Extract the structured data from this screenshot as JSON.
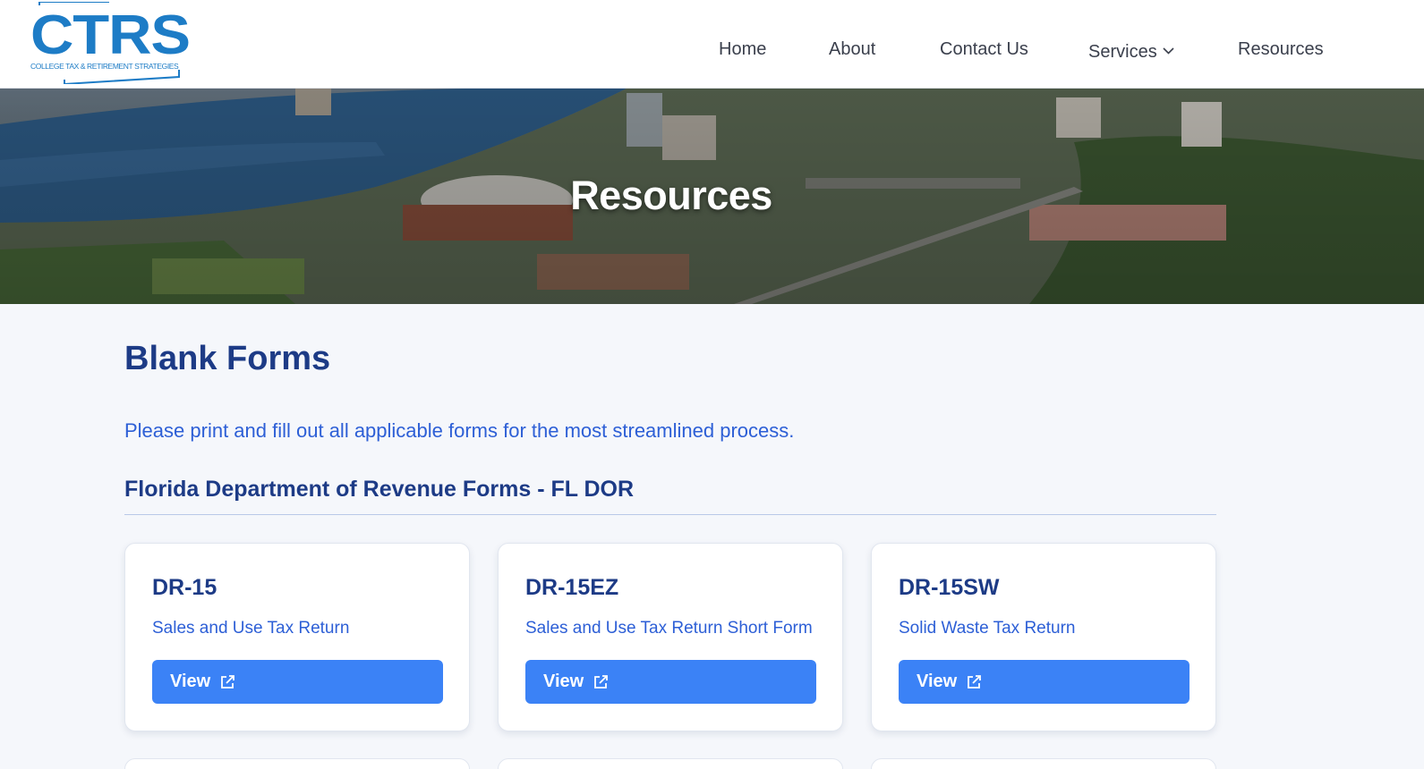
{
  "header": {
    "logo": {
      "text": "CTRS",
      "subtitle": "COLLEGE TAX & RETIREMENT STRATEGIES"
    },
    "nav": [
      {
        "label": "Home"
      },
      {
        "label": "About"
      },
      {
        "label": "Contact Us"
      },
      {
        "label": "Services",
        "has_dropdown": true
      },
      {
        "label": "Resources"
      }
    ]
  },
  "hero": {
    "title": "Resources"
  },
  "main": {
    "title": "Blank Forms",
    "intro": "Please print and fill out all applicable forms for the most streamlined process.",
    "section_title": "Florida Department of Revenue Forms - FL DOR",
    "cards": [
      {
        "title": "DR-15",
        "description": "Sales and Use Tax Return",
        "button_label": "View",
        "button_icon": "external-link-icon"
      },
      {
        "title": "DR-15EZ",
        "description": "Sales and Use Tax Return Short Form",
        "button_label": "View",
        "button_icon": "external-link-icon"
      },
      {
        "title": "DR-15SW",
        "description": "Solid Waste Tax Return",
        "button_label": "View",
        "button_icon": "external-link-icon"
      }
    ]
  },
  "colors": {
    "brand_blue": "#1d7cc6",
    "heading_navy": "#1d3b86",
    "link_blue": "#2d5fd6",
    "button_blue": "#3b82f6",
    "page_bg": "#f5f7fb"
  }
}
